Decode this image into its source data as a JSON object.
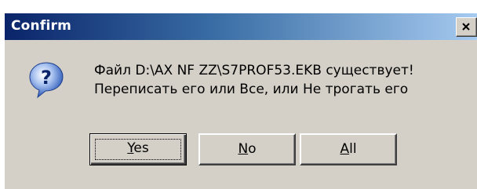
{
  "window": {
    "title": "Confirm",
    "close_label": "x"
  },
  "dialog": {
    "icon": "question-icon",
    "message_line1": "Файл D:\\AX NF ZZ\\S7PROF53.EKB существует!",
    "message_line2": "Переписать его или Все, или Не трогать его"
  },
  "buttons": {
    "yes_first": "Y",
    "yes_rest": "es",
    "no_first": "N",
    "no_rest": "o",
    "all_first": "A",
    "all_rest": "ll"
  },
  "colors": {
    "title_start": "#0a246a",
    "title_end": "#a6caf0",
    "face": "#d4d0c8"
  }
}
